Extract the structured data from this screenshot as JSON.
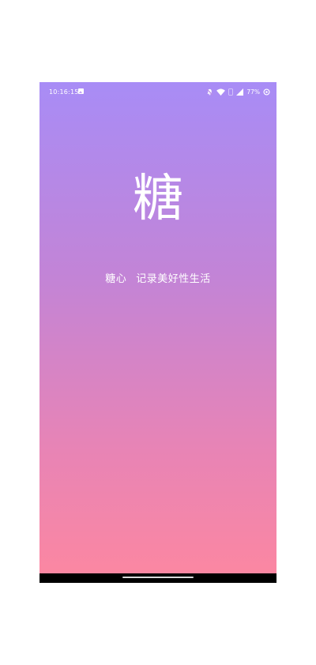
{
  "status_bar": {
    "time": "10:16:15",
    "battery": "77%"
  },
  "splash": {
    "logo": "糖",
    "app_name": "糖心",
    "slogan": "记录美好性生活"
  },
  "icons": {
    "status_left": [
      "image-icon"
    ],
    "status_right": [
      "bell-off-icon",
      "wifi-icon",
      "sim-icon",
      "signal-icon",
      "battery-saver-icon"
    ]
  },
  "colors": {
    "gradient_top": "#a88cf6",
    "gradient_bottom": "#fb87a2",
    "text": "#ffffff"
  }
}
